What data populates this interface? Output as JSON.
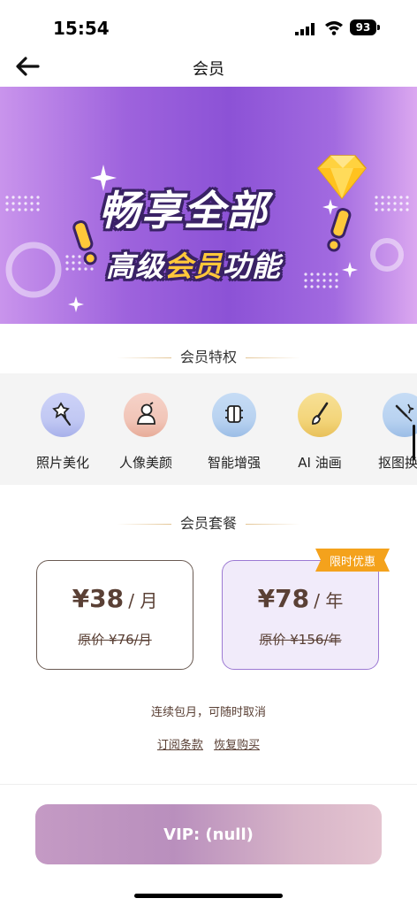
{
  "status_bar": {
    "time": "15:54",
    "battery": "93"
  },
  "nav": {
    "title": "会员"
  },
  "banner": {
    "line1": "畅享全部",
    "line2_prefix": "高级",
    "line2_highlight": "会员",
    "line2_suffix": "功能"
  },
  "privileges": {
    "title": "会员特权",
    "items": [
      {
        "label": "照片美化",
        "icon": "magic-wand-icon",
        "color": "#c5cbf6"
      },
      {
        "label": "人像美颜",
        "icon": "portrait-icon",
        "color": "#f3cbc0"
      },
      {
        "label": "智能增强",
        "icon": "enhance-icon",
        "color": "#bcd6f2"
      },
      {
        "label": "AI 油画",
        "icon": "paint-brush-icon",
        "color": "#f5dc8a"
      },
      {
        "label": "抠图换背",
        "icon": "cutout-icon",
        "color": "#bcd6f2"
      }
    ]
  },
  "packages": {
    "title": "会员套餐",
    "monthly": {
      "currency": "¥",
      "price": "38",
      "unit": "/ 月",
      "original": "原价 ¥76/月"
    },
    "yearly": {
      "currency": "¥",
      "price": "78",
      "unit": "/ 年",
      "original": "原价 ¥156/年",
      "tag": "限时优惠"
    },
    "note": "连续包月，可随时取消",
    "links": {
      "terms": "订阅条款",
      "restore": "恢复购买"
    }
  },
  "vip_button": {
    "label": "VIP: (null)"
  },
  "colors": {
    "accent": "#8c52d6",
    "price_brown": "#5a4035",
    "tag_orange": "#f4a21c"
  }
}
